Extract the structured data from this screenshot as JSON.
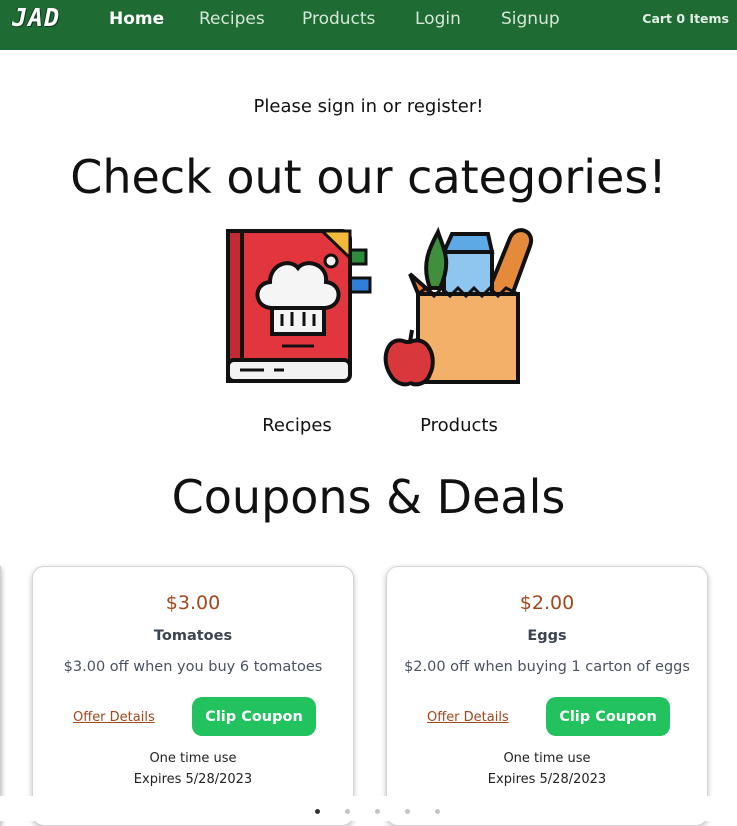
{
  "nav": {
    "logo": "JAD",
    "links": [
      "Home",
      "Recipes",
      "Products",
      "Login",
      "Signup"
    ],
    "active_link": "Home",
    "cart_label": "Cart 0 Items"
  },
  "signin_message": "Please sign in or register!",
  "categories": {
    "title": "Check out our categories!",
    "items": [
      {
        "label": "Recipes",
        "icon": "recipe-book-icon"
      },
      {
        "label": "Products",
        "icon": "grocery-bag-icon"
      }
    ]
  },
  "coupons": {
    "title": "Coupons & Deals",
    "cards": [
      {
        "price": "$3.00",
        "name": "Tomatoes",
        "description": "$3.00 off when you buy 6 tomatoes",
        "details_label": "Offer Details",
        "clip_label": "Clip Coupon",
        "usage": "One time use",
        "expires": "Expires 5/28/2023"
      },
      {
        "price": "$2.00",
        "name": "Eggs",
        "description": "$2.00 off when buying 1 carton of eggs",
        "details_label": "Offer Details",
        "clip_label": "Clip Coupon",
        "usage": "One time use",
        "expires": "Expires 5/28/2023"
      }
    ]
  },
  "carousel": {
    "dot_count": 5,
    "active_index": 0
  },
  "colors": {
    "navbar": "#1e6b33",
    "price": "#a3471c",
    "button": "#22c35e"
  }
}
